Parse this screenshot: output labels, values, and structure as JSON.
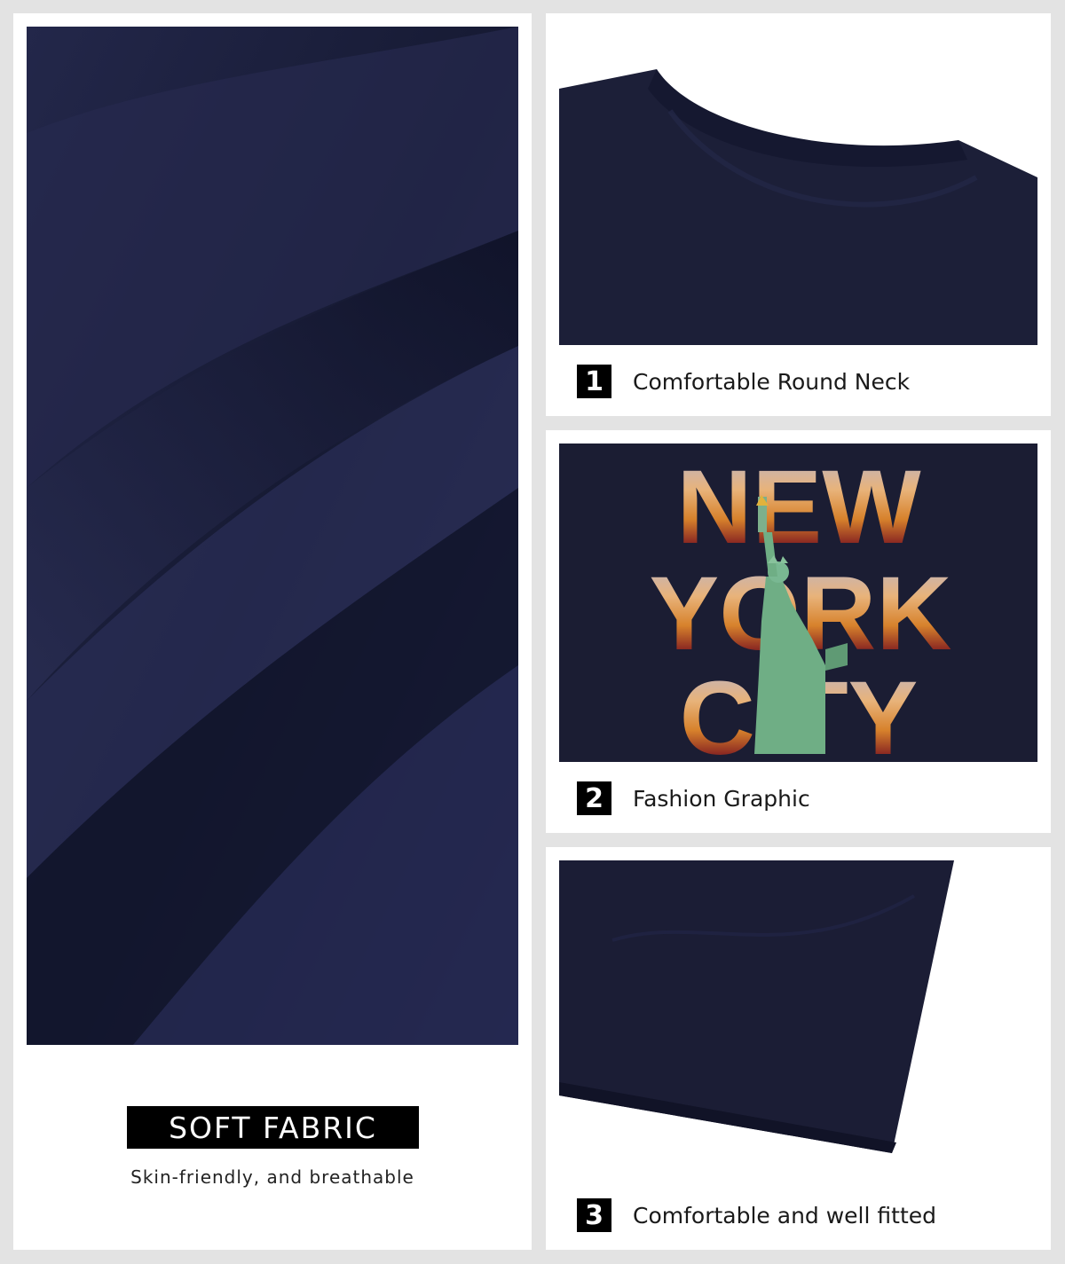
{
  "colors": {
    "background": "#e3e3e3",
    "card": "#ffffff",
    "fabric_navy": "#1b1e36",
    "badge": "#000000"
  },
  "fabric_panel": {
    "title": "SOFT FABRIC",
    "subtitle": "Skin-friendly, and breathable"
  },
  "features": [
    {
      "number": "1",
      "label": "Comfortable Round Neck"
    },
    {
      "number": "2",
      "label": "Fashion Graphic"
    },
    {
      "number": "3",
      "label": "Comfortable and well fitted"
    }
  ],
  "graphic": {
    "lines": [
      "NEW",
      "YORK",
      "CITY"
    ]
  }
}
